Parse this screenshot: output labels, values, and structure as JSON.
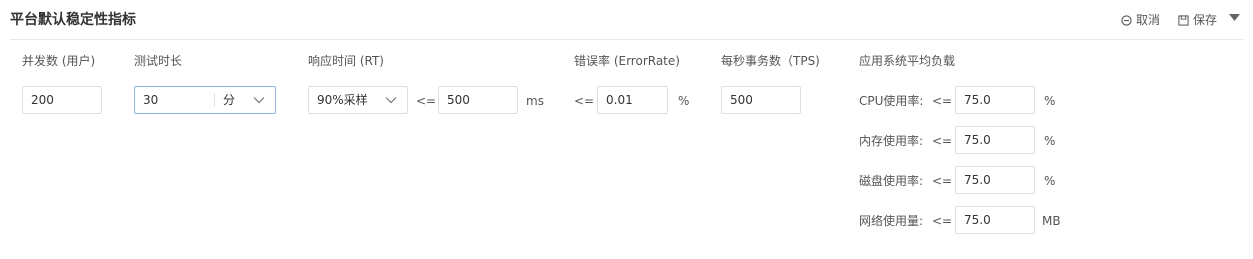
{
  "header": {
    "title": "平台默认稳定性指标",
    "cancel_label": "取消",
    "save_label": "保存"
  },
  "concurrency": {
    "label": "并发数 (用户)",
    "value": "200"
  },
  "duration": {
    "label": "测试时长",
    "value": "30",
    "unit": "分"
  },
  "response_time": {
    "label": "响应时间 (RT)",
    "percentile": "90%采样",
    "operator": "<=",
    "value": "500",
    "unit": "ms"
  },
  "error_rate": {
    "label": "错误率 (ErrorRate)",
    "operator": "<=",
    "value": "0.01",
    "unit": "%"
  },
  "tps": {
    "label": "每秒事务数（TPS)",
    "value": "500"
  },
  "system_load": {
    "label": "应用系统平均负载",
    "items": [
      {
        "name": "CPU使用率:",
        "operator": "<=",
        "value": "75.0",
        "unit": "%"
      },
      {
        "name": "内存使用率:",
        "operator": "<=",
        "value": "75.0",
        "unit": "%"
      },
      {
        "name": "磁盘使用率:",
        "operator": "<=",
        "value": "75.0",
        "unit": "%"
      },
      {
        "name": "网络使用量:",
        "operator": "<=",
        "value": "75.0",
        "unit": "MB"
      }
    ]
  }
}
